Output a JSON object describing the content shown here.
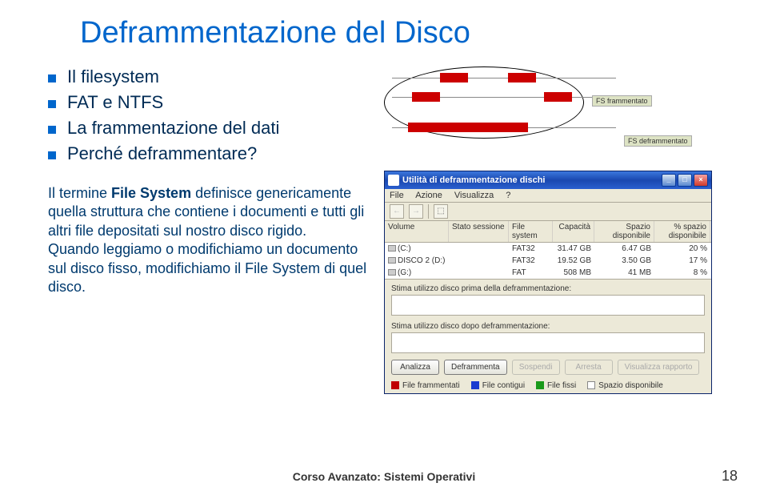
{
  "title": "Deframmentazione del Disco",
  "bullets": {
    "b1": "Il filesystem",
    "b2": "FAT e NTFS",
    "b3": "La frammentazione del dati",
    "b4": "Perché deframmentare?"
  },
  "paragraph": {
    "p1a": "Il termine ",
    "p1b": "File System",
    "p1c": " definisce genericamente quella struttura che contiene i documenti e tutti gli altri file depositati sul nostro disco rigido.",
    "p2": "Quando leggiamo o modifichiamo un documento sul disco fisso, modifichiamo il File System di quel disco."
  },
  "frag_labels": {
    "fragmented": "FS frammentato",
    "defragmented": "FS deframmentato"
  },
  "window": {
    "title": "Utilità di deframmentazione dischi",
    "menu": {
      "file": "File",
      "azione": "Azione",
      "visualizza": "Visualizza",
      "help": "?"
    },
    "headers": {
      "volume": "Volume",
      "stato": "Stato sessione",
      "fs": "File system",
      "cap": "Capacità",
      "disp": "Spazio disponibile",
      "pct": "% spazio disponibile"
    },
    "rows": [
      {
        "vol": "(C:)",
        "stato": "",
        "fs": "FAT32",
        "cap": "31.47 GB",
        "disp": "6.47 GB",
        "pct": "20 %"
      },
      {
        "vol": "DISCO 2 (D:)",
        "stato": "",
        "fs": "FAT32",
        "cap": "19.52 GB",
        "disp": "3.50 GB",
        "pct": "17 %"
      },
      {
        "vol": "(G:)",
        "stato": "",
        "fs": "FAT",
        "cap": "508 MB",
        "disp": "41 MB",
        "pct": "8 %"
      }
    ],
    "section1": "Stima utilizzo disco prima della deframmentazione:",
    "section2": "Stima utilizzo disco dopo deframmentazione:",
    "buttons": {
      "analizza": "Analizza",
      "deframmenta": "Deframmenta",
      "sospendi": "Sospendi",
      "arresta": "Arresta",
      "rapporto": "Visualizza rapporto"
    },
    "legend": {
      "frammentati": "File frammentati",
      "contigui": "File contigui",
      "fissi": "File fissi",
      "spazio": "Spazio disponibile"
    },
    "legend_colors": {
      "frammentati": "#c00000",
      "contigui": "#1a3cd0",
      "fissi": "#1a9a1a",
      "spazio": "#ffffff"
    }
  },
  "footer": {
    "text": "Corso Avanzato: Sistemi Operativi",
    "page": "18"
  }
}
